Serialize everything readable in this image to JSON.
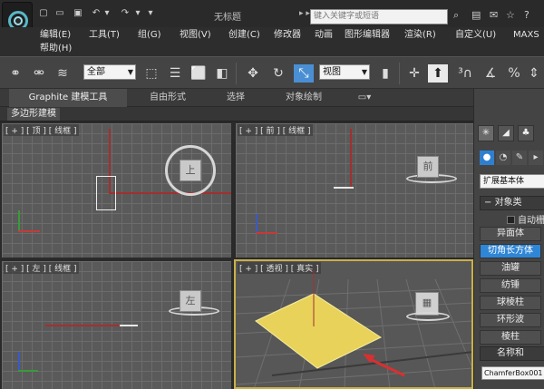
{
  "titlebar": {
    "title": "无标题",
    "search_placeholder": "键入关键字或短语",
    "nav_arrows": "▸ ▸"
  },
  "menu": {
    "items": [
      "编辑(E)",
      "工具(T)",
      "组(G)",
      "视图(V)",
      "创建(C)",
      "修改器",
      "动画",
      "图形编辑器",
      "渲染(R)",
      "自定义(U)",
      "MAXS"
    ],
    "help": "帮助(H)"
  },
  "toolbar": {
    "selection_filter": "全部",
    "ref_coord": "视图"
  },
  "ribbon": {
    "tabs": [
      "Graphite 建模工具",
      "自由形式",
      "选择",
      "对象绘制"
    ],
    "active_tab": "Graphite 建模工具",
    "sub_label": "多边形建模"
  },
  "viewports": {
    "top": {
      "label": "[ + ] [ 顶 ] [ 线框 ]",
      "cube_face": "上"
    },
    "front": {
      "label": "[ + ] [ 前 ] [ 线框 ]",
      "cube_face": "前"
    },
    "left": {
      "label": "[ + ] [ 左 ] [ 线框 ]",
      "cube_face": "左"
    },
    "perspective": {
      "label": "[ + ] [ 透视 ] [ 真实 ]"
    }
  },
  "command_panel": {
    "primitive_type": "扩展基本体",
    "object_type_header": "对象类",
    "autogrid_label": "自动栅",
    "object_buttons": [
      "异面体",
      "切角长方体",
      "油罐",
      "纺锤",
      "球棱柱",
      "环形波",
      "棱柱"
    ],
    "active_object": "切角长方体",
    "name_color_header": "名称和",
    "object_name": "ChamferBox001"
  },
  "colors": {
    "accent": "#2f86d6",
    "viewport_active_border": "#c9b04a",
    "box_fill": "#e8d25a"
  }
}
